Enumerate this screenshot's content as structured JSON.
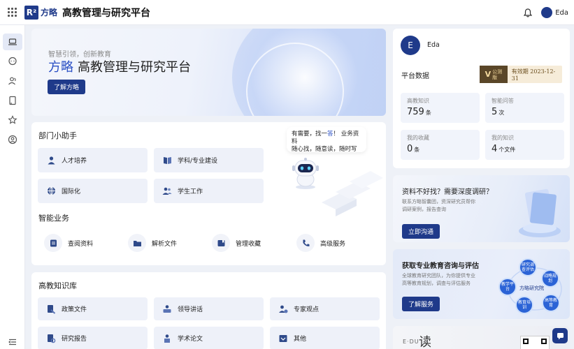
{
  "header": {
    "logo_mark": "R²",
    "logo_brand": "方略",
    "title": "高教管理与研究平台",
    "user_name": "Eda"
  },
  "sidebar": {
    "items": [
      {
        "icon": "laptop-icon",
        "active": true
      },
      {
        "icon": "chat-bubble-icon",
        "active": false
      },
      {
        "icon": "people-icon",
        "active": false
      },
      {
        "icon": "book-icon",
        "active": false
      },
      {
        "icon": "star-icon",
        "active": false
      },
      {
        "icon": "user-circle-icon",
        "active": false
      },
      {
        "icon": "menu-collapse-icon",
        "active": false
      }
    ]
  },
  "banner": {
    "subtitle": "智慧引领，创新教育",
    "title_brand": "方略",
    "title_rest": "高教管理与研究平台",
    "button": "了解方略"
  },
  "department": {
    "title": "部门小助手",
    "tiles": [
      {
        "label": "人才培养",
        "icon": "person-icon"
      },
      {
        "label": "学科/专业建设",
        "icon": "book-open-icon"
      },
      {
        "label": "国际化",
        "icon": "globe-icon"
      },
      {
        "label": "学生工作",
        "icon": "students-icon"
      }
    ],
    "bubble_line1_a": "有需要，找一",
    "bubble_line1_b": "答",
    "bubble_line1_c": "！ 业务资料",
    "bubble_line2": "随心找，随意读，随时写"
  },
  "business": {
    "title": "智能业务",
    "items": [
      {
        "label": "查阅资料",
        "icon": "document-icon"
      },
      {
        "label": "解析文件",
        "icon": "folder-icon"
      },
      {
        "label": "管理收藏",
        "icon": "bookmark-icon"
      },
      {
        "label": "高级服务",
        "icon": "phone-icon"
      }
    ]
  },
  "knowledge": {
    "title": "高教知识库",
    "items": [
      {
        "label": "政策文件",
        "icon": "policy-icon"
      },
      {
        "label": "领导讲话",
        "icon": "speech-icon"
      },
      {
        "label": "专家观点",
        "icon": "expert-icon"
      },
      {
        "label": "研究报告",
        "icon": "report-icon"
      },
      {
        "label": "学术论文",
        "icon": "paper-icon"
      },
      {
        "label": "其他",
        "icon": "other-icon"
      }
    ]
  },
  "profile": {
    "avatar_letter": "E",
    "name": "Eda",
    "stats_title": "平台数据",
    "vip_letter": "V",
    "vip_line1": "公测",
    "vip_line2": "版",
    "expiry": "有效期 2023-12-31",
    "stats": [
      {
        "label": "高教知识",
        "value": "759",
        "unit": "条"
      },
      {
        "label": "智能问答",
        "value": "5",
        "unit": "次"
      },
      {
        "label": "我的收藏",
        "value": "0",
        "unit": "条"
      },
      {
        "label": "我的知识",
        "value": "4",
        "unit": "个文件"
      }
    ]
  },
  "promo_research": {
    "title": "资料不好找？需要深度调研？",
    "desc_line1": "联系方略智囊团，资深研究员帮你",
    "desc_line2": "调研案例，报告查询",
    "button": "立即沟通"
  },
  "promo_consult": {
    "title": "获取专业教育咨询与评估",
    "desc_line1": "全球教育研究团队，为你提供专业",
    "desc_line2": "高等教育规划，调查与评估服务",
    "button": "了解服务",
    "center_label": "方略研究院",
    "bubbles": [
      "研究调查评估",
      "战略规划",
      "教学平台",
      "高等教育",
      "教育培训"
    ]
  },
  "read_card": {
    "edu": "E·DU",
    "du": "读"
  },
  "colors": {
    "primary": "#1f3a8a",
    "accent": "#2a4fc4",
    "tile_bg": "#eef1f9",
    "page_bg": "#eef1f7"
  }
}
